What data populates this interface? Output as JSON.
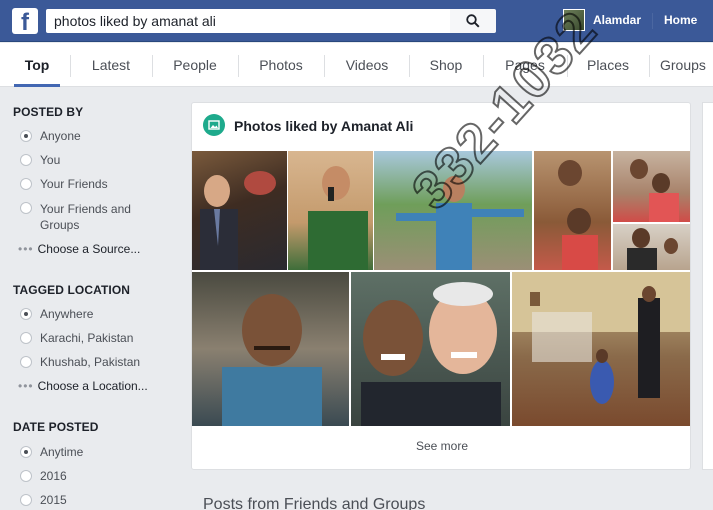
{
  "topbar": {
    "logo": "f",
    "search_value": "photos liked by amanat ali",
    "user_name": "Alamdar",
    "home_label": "Home"
  },
  "tabs": [
    {
      "label": "Top",
      "active": true
    },
    {
      "label": "Latest"
    },
    {
      "label": "People"
    },
    {
      "label": "Photos"
    },
    {
      "label": "Videos"
    },
    {
      "label": "Shop"
    },
    {
      "label": "Pages"
    },
    {
      "label": "Places"
    },
    {
      "label": "Groups"
    }
  ],
  "filters": {
    "posted_by": {
      "heading": "POSTED BY",
      "options": [
        "Anyone",
        "You",
        "Your Friends",
        "Your Friends and Groups"
      ],
      "choose": "Choose a Source..."
    },
    "tagged_location": {
      "heading": "TAGGED LOCATION",
      "options": [
        "Anywhere",
        "Karachi, Pakistan",
        "Khushab, Pakistan"
      ],
      "choose": "Choose a Location..."
    },
    "date_posted": {
      "heading": "DATE POSTED",
      "options": [
        "Anytime",
        "2016",
        "2015"
      ]
    }
  },
  "results": {
    "title": "Photos liked by Amanat Ali",
    "see_more": "See more"
  },
  "posts_heading": "Posts from Friends and Groups",
  "watermark": "332-1032",
  "colors": {
    "brand": "#3b5998",
    "accent": "#4267b2",
    "photo_icon": "#1eaa8c"
  }
}
